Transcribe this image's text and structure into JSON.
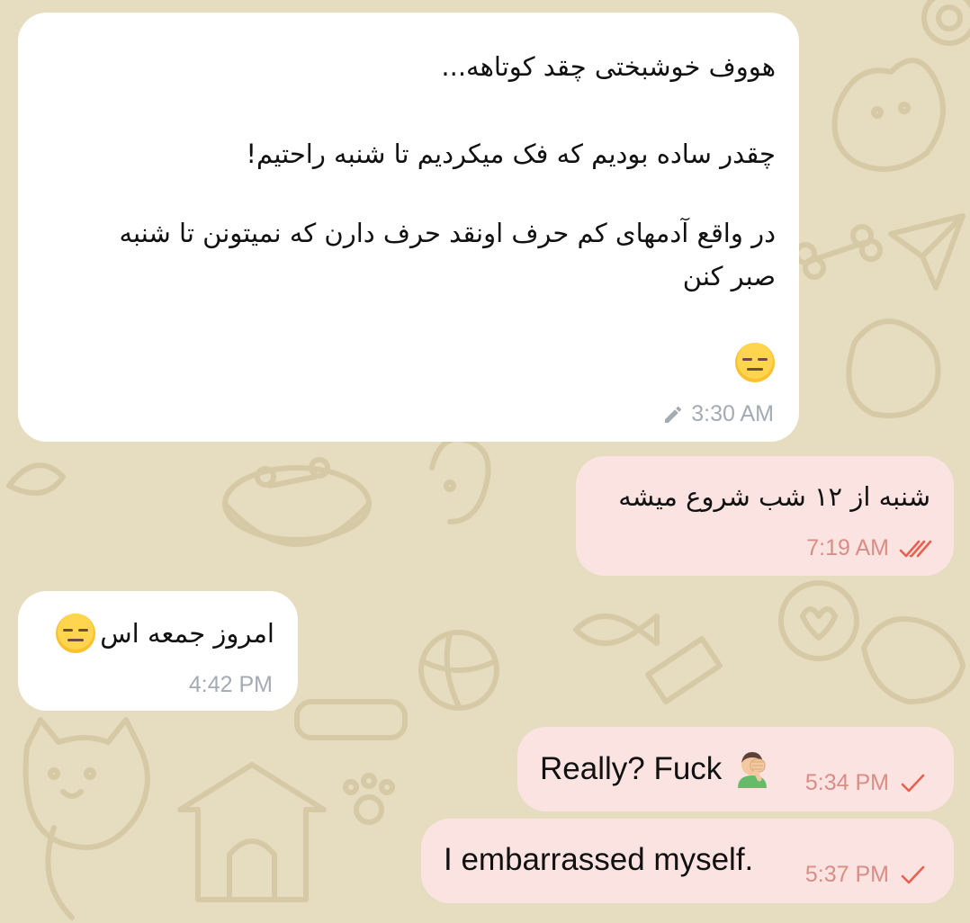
{
  "messages": [
    {
      "direction": "incoming",
      "lines": [
        "هووف خوشبختی چقد کوتاهه...",
        "چقدر ساده بودیم که فک میکردیم تا شنبه راحتیم!",
        "در واقع آدمهای کم حرف اونقد حرف دارن که نمیتونن تا شنبه",
        "صبر کنن"
      ],
      "emoji": "expressionless-face",
      "edited": true,
      "time": "3:30 AM"
    },
    {
      "direction": "outgoing",
      "text": "شنبه از ۱۲ شب شروع میشه",
      "time": "7:19 AM",
      "status": "read"
    },
    {
      "direction": "incoming",
      "text": "امروز جمعه اس",
      "emoji": "expressionless-face",
      "time": "4:42 PM"
    },
    {
      "direction": "outgoing",
      "text": "Really? Fuck",
      "emoji": "man-facepalming",
      "time": "5:34 PM",
      "status": "sent"
    },
    {
      "direction": "outgoing",
      "text": "I embarrassed myself.",
      "time": "5:37 PM",
      "status": "sent"
    }
  ],
  "colors": {
    "background": "#e6dcc0",
    "incoming_bubble": "#ffffff",
    "outgoing_bubble": "#fbe3e1",
    "incoming_time": "#a4abb3",
    "outgoing_time": "#d88e86",
    "checkmark": "#e8604f"
  }
}
